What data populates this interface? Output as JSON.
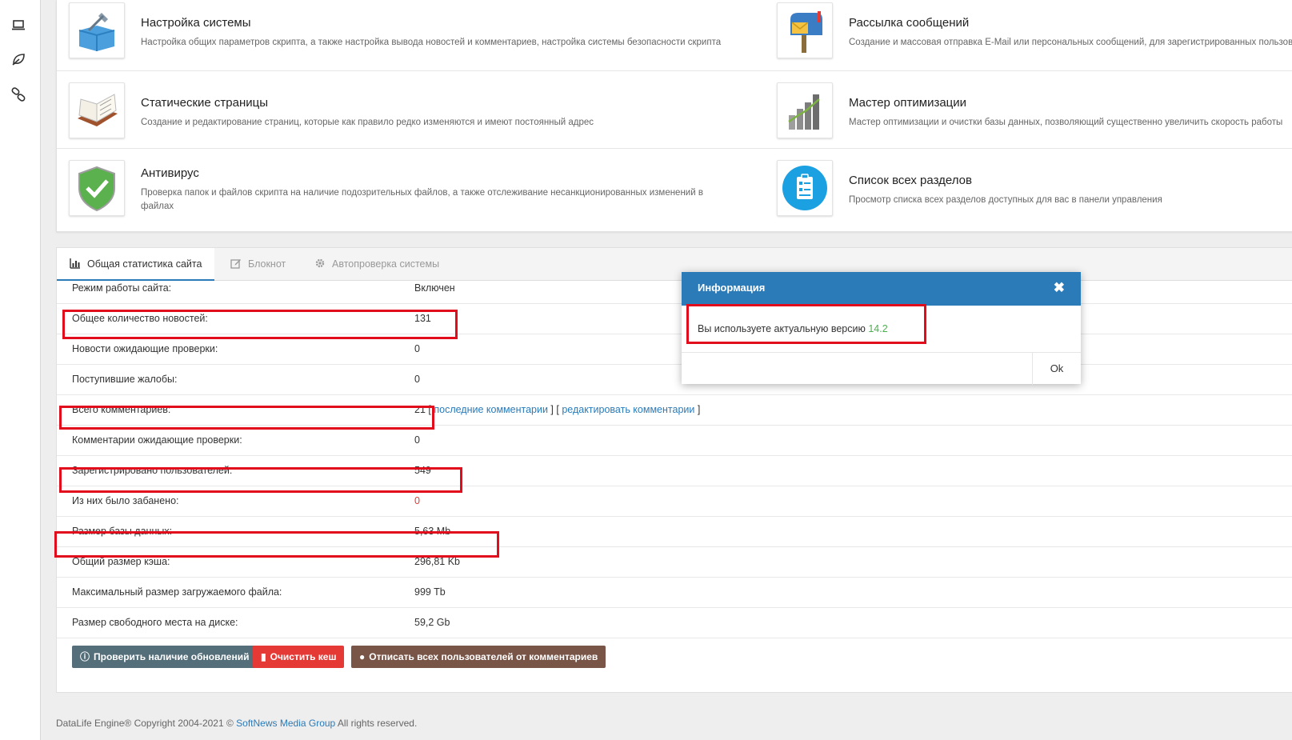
{
  "sidebar": {
    "icons": [
      "laptop-icon",
      "leaf-icon",
      "link-icon"
    ]
  },
  "quick_panel": {
    "items": [
      {
        "title": "Настройка системы",
        "desc": "Настройка общих параметров скрипта, а также настройка вывода новостей и комментариев, настройка системы безопасности скрипта",
        "icon": "toolbox-icon"
      },
      {
        "title": "Рассылка сообщений",
        "desc": "Создание и массовая отправка E-Mail или персональных сообщений, для зарегистрированных пользователей",
        "icon": "mailbox-icon"
      },
      {
        "title": "Статические страницы",
        "desc": "Создание и редактирование страниц, которые как правило редко изменяются и имеют постоянный адрес",
        "icon": "book-icon"
      },
      {
        "title": "Мастер оптимизации",
        "desc": "Мастер оптимизации и очистки базы данных, позволяющий существенно увеличить скорость работы",
        "icon": "growth-chart-icon"
      },
      {
        "title": "Антивирус",
        "desc": "Проверка папок и файлов скрипта на наличие подозрительных файлов, а также отслеживание несанкционированных изменений в файлах",
        "icon": "shield-check-icon"
      },
      {
        "title": "Список всех разделов",
        "desc": "Просмотр списка всех разделов доступных для вас в панели управления",
        "icon": "clipboard-list-icon"
      }
    ]
  },
  "tabs": [
    {
      "label": "Общая статистика сайта",
      "icon": "bar-chart-icon",
      "active": true
    },
    {
      "label": "Блокнот",
      "icon": "edit-icon",
      "active": false
    },
    {
      "label": "Автопроверка системы",
      "icon": "gear-icon",
      "active": false
    }
  ],
  "stats": [
    {
      "label": "Режим работы сайта:",
      "value": "Включен"
    },
    {
      "label": "Общее количество новостей:",
      "value": "131",
      "highlight": true
    },
    {
      "label": "Новости ожидающие проверки:",
      "value": "0"
    },
    {
      "label": "Поступившие жалобы:",
      "value": "0"
    },
    {
      "label": "Всего комментариев:",
      "value": "21",
      "highlight": true,
      "links": [
        "последние комментарии",
        "редактировать комментарии"
      ]
    },
    {
      "label": "Комментарии ожидающие проверки:",
      "value": "0"
    },
    {
      "label": "Зарегистрировано пользователей:",
      "value": "549",
      "highlight": true
    },
    {
      "label": "Из них было забанено:",
      "value": "0",
      "value_color": "#e53935"
    },
    {
      "label": "Размер базы данных:",
      "value": "5,63 Mb",
      "highlight": true
    },
    {
      "label": "Общий размер кэша:",
      "value": "296,81 Kb"
    },
    {
      "label": "Максимальный размер загружаемого файла:",
      "value": "999 Tb"
    },
    {
      "label": "Размер свободного места на диске:",
      "value": "59,2 Gb"
    }
  ],
  "actions": [
    {
      "label": "Проверить наличие обновлений",
      "icon": "info-circle-icon",
      "color": "#546e7a"
    },
    {
      "label": "Очистить кеш",
      "icon": "trash-icon",
      "color": "#e53935"
    },
    {
      "label": "Отписать всех пользователей от комментариев",
      "icon": "user-icon",
      "color": "#795548"
    }
  ],
  "footer": {
    "prefix": "DataLife Engine® Copyright 2004-2021 ©",
    "company": "SoftNews Media Group",
    "suffix": "All rights reserved."
  },
  "modal": {
    "title": "Информация",
    "message": "Вы используете актуальную версию",
    "version": "14.2",
    "ok_label": "Ok"
  },
  "colors": {
    "accent": "#2b7bb9",
    "highlight_border": "#e10d1d",
    "version_green": "#4caf50"
  }
}
